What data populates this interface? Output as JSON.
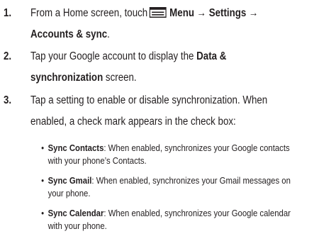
{
  "steps": [
    {
      "number": "1.",
      "line1_pre": "From a Home screen, touch",
      "line1_menu_icon": "menu-icon",
      "line1_bold": "Menu → Settings →",
      "line2_bold": "Accounts & sync",
      "line2_post": "."
    },
    {
      "number": "2.",
      "line1_pre": "Tap your Google account to display the",
      "line1_bold": "Data &",
      "line2_bold": "synchronization",
      "line2_post": " screen."
    },
    {
      "number": "3.",
      "line1": "Tap a setting to enable or disable synchronization. When",
      "line2": "enabled, a check mark appears in the check box:"
    }
  ],
  "bullets": [
    {
      "symbol": "•",
      "label": "Sync Contacts",
      "line1": ": When enabled, synchronizes your Google contacts",
      "line2": "with your phone’s Contacts."
    },
    {
      "symbol": "•",
      "label": "Sync Gmail",
      "line1": ": When enabled, synchronizes your Gmail messages on",
      "line2": "your phone."
    },
    {
      "symbol": "•",
      "label": "Sync Calendar",
      "line1": ": When enabled, synchronizes your Google calendar",
      "line2": "with your phone."
    }
  ]
}
